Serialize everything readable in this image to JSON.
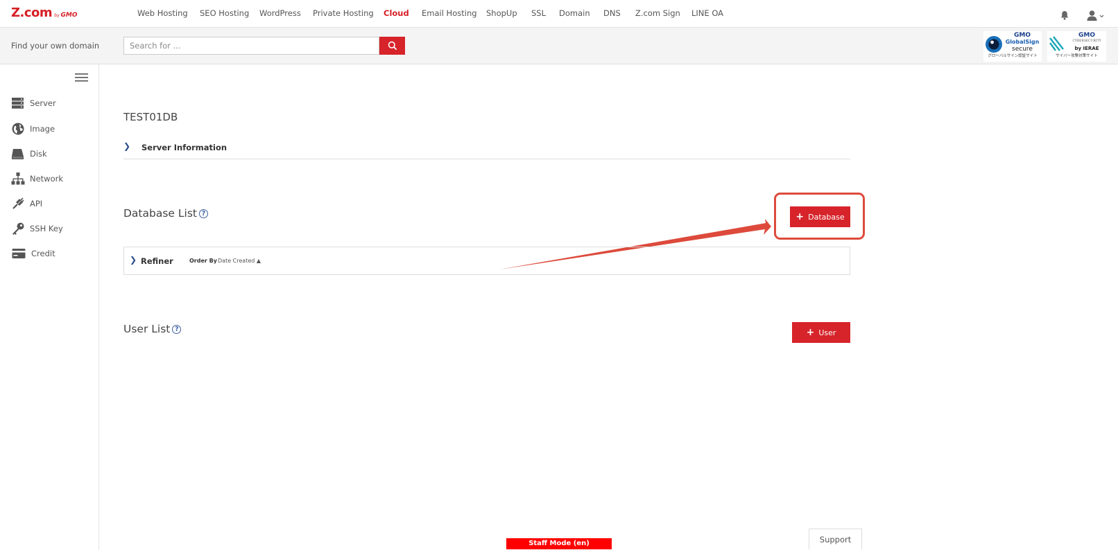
{
  "brand": {
    "logo_text": "Z.com",
    "logo_by": "by",
    "logo_gmo": "GMO"
  },
  "topnav": {
    "items": [
      {
        "label": "Web Hosting"
      },
      {
        "label": "SEO Hosting"
      },
      {
        "label": "WordPress"
      },
      {
        "label": "Private Hosting"
      },
      {
        "label": "Cloud"
      },
      {
        "label": "Email Hosting"
      },
      {
        "label": "ShopUp"
      },
      {
        "label": "SSL"
      },
      {
        "label": "Domain"
      },
      {
        "label": "DNS"
      },
      {
        "label": "Z.com Sign"
      },
      {
        "label": "LINE OA"
      }
    ],
    "active": "Cloud",
    "icons": [
      "bell-icon",
      "user-icon"
    ]
  },
  "search": {
    "label": "Find your own domain",
    "placeholder": "Search for ..."
  },
  "badges": {
    "globalsign": {
      "line1": "GMO",
      "line2": "GlobalSign",
      "line3": "secure",
      "line4": "グローバルサイン認証サイト"
    },
    "cybersecurity": {
      "line1": "GMO",
      "line2": "CYBERSECURITY",
      "line3": "by IERAE",
      "line4": "サイバー攻撃対策サイト"
    }
  },
  "sidebar": {
    "items": [
      {
        "label": "Server",
        "icon": "server-icon"
      },
      {
        "label": "Image",
        "icon": "globe-icon"
      },
      {
        "label": "Disk",
        "icon": "disk-icon"
      },
      {
        "label": "Network",
        "icon": "network-icon"
      },
      {
        "label": "API",
        "icon": "api-icon"
      },
      {
        "label": "SSH Key",
        "icon": "key-icon"
      },
      {
        "label": "Credit",
        "icon": "credit-card-icon"
      }
    ]
  },
  "main": {
    "title": "TEST01DB",
    "server_info": "Server Information",
    "database_list": {
      "title": "Database List",
      "button": "Database"
    },
    "refiner": {
      "label": "Refiner",
      "order_by": "Order By",
      "order_value": "Date Created ▲"
    },
    "user_list": {
      "title": "User List",
      "button": "User"
    }
  },
  "footer": {
    "staff_mode": "Staff Mode (en)",
    "support": "Support"
  },
  "colors": {
    "accent": "#d6242a",
    "highlight": "#dd4a3c",
    "link": "#2a4c8a"
  }
}
